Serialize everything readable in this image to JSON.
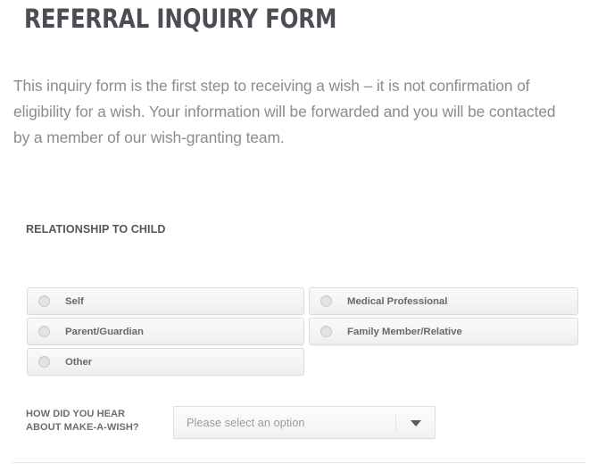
{
  "page": {
    "title": "REFERRAL INQUIRY FORM",
    "intro": "This inquiry form is the first step to receiving a wish – it is not confirmation of eligibility for a wish. Your information will be forwarded and you will be contacted by a member of our wish-granting team."
  },
  "relationship_section": {
    "heading": "RELATIONSHIP TO CHILD",
    "left_options": [
      {
        "label": "Self",
        "selected": false,
        "icon": "radio-unchecked-icon"
      },
      {
        "label": "Parent/Guardian",
        "selected": false,
        "icon": "radio-unchecked-icon"
      },
      {
        "label": "Other",
        "selected": false,
        "icon": "radio-unchecked-icon"
      }
    ],
    "right_options": [
      {
        "label": "Medical Professional",
        "selected": false,
        "icon": "radio-unchecked-icon"
      },
      {
        "label": "Family Member/Relative",
        "selected": false,
        "icon": "radio-unchecked-icon"
      }
    ]
  },
  "referral_source": {
    "label_line1": "HOW DID YOU HEAR",
    "label_line2": "ABOUT MAKE-A-WISH?",
    "select_value": "",
    "select_placeholder": "Please select an option",
    "arrow_icon": "chevron-down-icon"
  },
  "colors": {
    "title_text": "#4c4c54",
    "body_text": "#8c8c8c",
    "heading_text": "#56565c",
    "option_label_text": "#68686e",
    "placeholder_text": "#9b9b9b",
    "field_border": "#dcdcdc",
    "divider": "#e6e6e6",
    "page_background": "#ffffff"
  }
}
